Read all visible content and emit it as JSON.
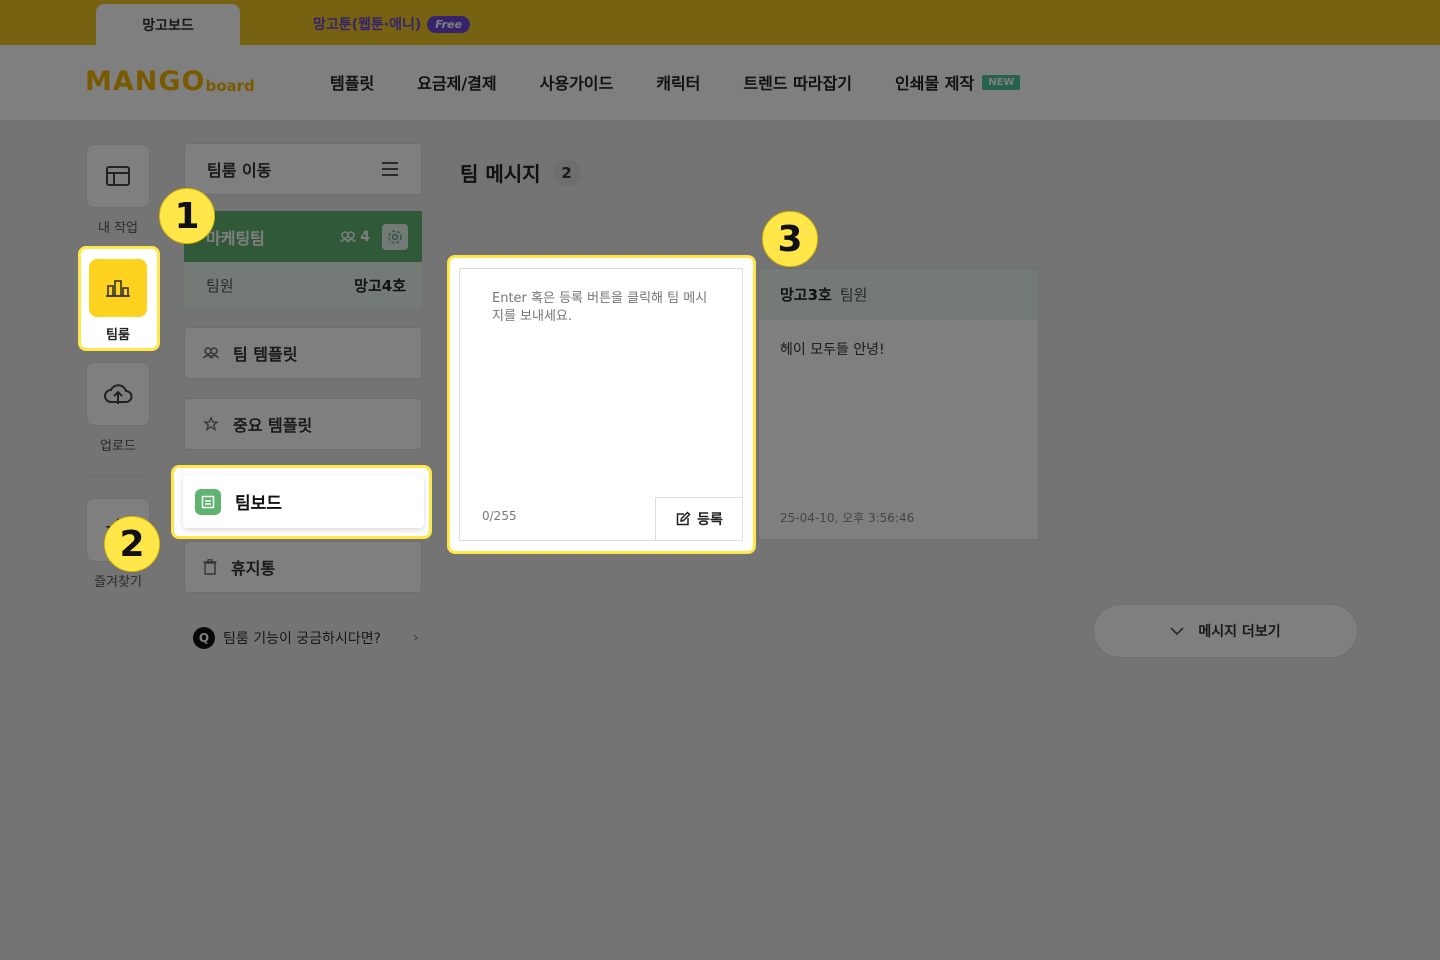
{
  "tabs": {
    "active": "망고보드",
    "webtoon": "망고툰(웹툰·애니)",
    "webtoon_badge": "Free"
  },
  "logo": {
    "main": "MANGO",
    "sub": "board"
  },
  "nav": {
    "items": [
      "템플릿",
      "요금제/결제",
      "사용가이드",
      "캐릭터",
      "트렌드 따라잡기",
      "인쇄물 제작"
    ],
    "new_badge": "NEW"
  },
  "rail": {
    "my_work": "내 작업",
    "team_room": "팀룸",
    "upload": "업로드",
    "favorites": "즐겨찾기"
  },
  "team_panel": {
    "move_label": "팀룸 이동",
    "team_name": "마케팅팀",
    "member_count": "4",
    "role_label": "팀원",
    "member_name": "망고4호",
    "menu": {
      "team_templates": "팀 템플릿",
      "important_templates": "중요 템플릿",
      "team_board": "팀보드",
      "trash": "휴지통"
    },
    "help": "팀룸 기능이 궁금하시다면?"
  },
  "messages": {
    "title": "팀 메시지",
    "count": "2",
    "input_placeholder": "Enter 혹은 등록 버튼을 클릭해 팀 메시지를 보내세요.",
    "counter": "0/255",
    "register_label": "등록",
    "card": {
      "author": "망고3호",
      "role": "팀원",
      "body": "헤이 모두들 안녕!",
      "time": "25-04-10, 오후 3:56:46"
    },
    "more_label": "메시지 더보기"
  },
  "callouts": [
    "1",
    "2",
    "3"
  ],
  "colors": {
    "brand_yellow": "#efc425",
    "team_green": "#5fb370",
    "highlight": "#ffe74a",
    "free_purple": "#6a48d8",
    "new_green": "#4ec59a"
  }
}
